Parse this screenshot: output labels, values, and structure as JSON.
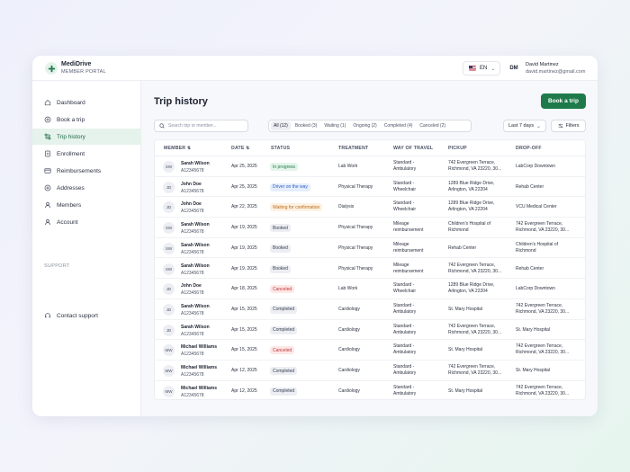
{
  "app": {
    "name": "MediDrive",
    "subtitle": "MEMBER PORTAL"
  },
  "language": {
    "code": "EN"
  },
  "user": {
    "initials": "DM",
    "name": "David Martinez",
    "email": "david.martinez@gmail.com"
  },
  "sidebar": {
    "items": [
      {
        "label": "Dashboard",
        "icon": "home-icon"
      },
      {
        "label": "Book a trip",
        "icon": "plus-circle-icon"
      },
      {
        "label": "Trip history",
        "icon": "route-icon",
        "active": true
      },
      {
        "label": "Enrollment",
        "icon": "document-icon"
      },
      {
        "label": "Reimbursements",
        "icon": "card-icon"
      },
      {
        "label": "Addresses",
        "icon": "location-icon"
      },
      {
        "label": "Members",
        "icon": "users-icon"
      },
      {
        "label": "Account",
        "icon": "user-icon"
      }
    ],
    "support_label": "SUPPORT",
    "support_items": [
      {
        "label": "Contact support",
        "icon": "headset-icon"
      }
    ]
  },
  "main": {
    "title": "Trip history",
    "book_button": "Book a trip",
    "search_placeholder": "Search trip or member...",
    "status_filters": [
      {
        "label": "All (12)",
        "active": true
      },
      {
        "label": "Booked (3)"
      },
      {
        "label": "Waiting (1)"
      },
      {
        "label": "Ongoing (2)"
      },
      {
        "label": "Completed (4)"
      },
      {
        "label": "Canceled (2)"
      }
    ],
    "date_range": "Last 7 days",
    "filters_button": "Filters"
  },
  "table": {
    "headers": {
      "member": "MEMBER ⇅",
      "date": "DATE ⇅",
      "status": "STATUS",
      "treatment": "TREATMENT",
      "travel": "WAY OF TRAVEL",
      "pickup": "PICKUP",
      "dropoff": "DROP-OFF"
    },
    "status_colors": {
      "In progress": {
        "bg": "#e4f5ea",
        "fg": "#1e7a4b"
      },
      "Driver on the way": {
        "bg": "#e6eefc",
        "fg": "#2b5fbf"
      },
      "Waiting for confirmation": {
        "bg": "#fdf1e2",
        "fg": "#b86a12"
      },
      "Booked": {
        "bg": "#eceef3",
        "fg": "#3a4152"
      },
      "Canceled": {
        "bg": "#fde7e7",
        "fg": "#c23434"
      },
      "Completed": {
        "bg": "#eceef3",
        "fg": "#3a4152"
      }
    },
    "rows": [
      {
        "initials": "SW",
        "name": "Sarah Wilson",
        "id": "A12345678",
        "date": "Apr 25, 2025",
        "status": "In progress",
        "treatment": "Lab Work",
        "travel1": "Standard -",
        "travel2": "Ambulatory",
        "pickup1": "742 Evergreen Terrace,",
        "pickup2": "Richmond, VA 23220, 30...",
        "dropoff1": "LabCorp Downtown",
        "dropoff2": ""
      },
      {
        "initials": "JD",
        "name": "John Doe",
        "id": "A12345678",
        "date": "Apr 25, 2025",
        "status": "Driver on the way",
        "treatment": "Physical Therapy",
        "travel1": "Standard -",
        "travel2": "Wheelchair",
        "pickup1": "1289 Blue Ridge Drive,",
        "pickup2": "Arlington, VA 22204",
        "dropoff1": "Rehab Center",
        "dropoff2": ""
      },
      {
        "initials": "JD",
        "name": "John Doe",
        "id": "A12345678",
        "date": "Apr 22, 2025",
        "status": "Waiting for confirmation",
        "treatment": "Dialysis",
        "travel1": "Standard -",
        "travel2": "Wheelchair",
        "pickup1": "1289 Blue Ridge Drive,",
        "pickup2": "Arlington, VA 22204",
        "dropoff1": "VCU Medical Center",
        "dropoff2": ""
      },
      {
        "initials": "SW",
        "name": "Sarah Wilson",
        "id": "A12345678",
        "date": "Apr 19, 2025",
        "status": "Booked",
        "treatment": "Physical Therapy",
        "travel1": "Mileage",
        "travel2": "reimbursement",
        "pickup1": "Children's Hospital of",
        "pickup2": "Richmond",
        "dropoff1": "742 Evergreen Terrace,",
        "dropoff2": "Richmond, VA 23220, 30..."
      },
      {
        "initials": "SW",
        "name": "Sarah Wilson",
        "id": "A12345678",
        "date": "Apr 19, 2025",
        "status": "Booked",
        "treatment": "Physical Therapy",
        "travel1": "Mileage",
        "travel2": "reimbursement",
        "pickup1": "Rehab Center",
        "pickup2": "",
        "dropoff1": "Children's Hospital of",
        "dropoff2": "Richmond"
      },
      {
        "initials": "SW",
        "name": "Sarah Wilson",
        "id": "A12345678",
        "date": "Apr 19, 2025",
        "status": "Booked",
        "treatment": "Physical Therapy",
        "travel1": "Mileage",
        "travel2": "reimbursement",
        "pickup1": "742 Evergreen Terrace,",
        "pickup2": "Richmond, VA 23220, 30...",
        "dropoff1": "Rehab Center",
        "dropoff2": ""
      },
      {
        "initials": "JD",
        "name": "John Doe",
        "id": "A12345678",
        "date": "Apr 18, 2025",
        "status": "Canceled",
        "treatment": "Lab Work",
        "travel1": "Standard -",
        "travel2": "Wheelchair",
        "pickup1": "1289 Blue Ridge Drive,",
        "pickup2": "Arlington, VA 22204",
        "dropoff1": "LabCorp Downtown",
        "dropoff2": ""
      },
      {
        "initials": "JD",
        "name": "Sarah Wilson",
        "id": "A12345678",
        "date": "Apr 15, 2025",
        "status": "Completed",
        "treatment": "Cardiology",
        "travel1": "Standard -",
        "travel2": "Ambulatory",
        "pickup1": "St. Mary Hospital",
        "pickup2": "",
        "dropoff1": "742 Evergreen Terrace,",
        "dropoff2": "Richmond, VA 23220, 30..."
      },
      {
        "initials": "JD",
        "name": "Sarah Wilson",
        "id": "A12345678",
        "date": "Apr 15, 2025",
        "status": "Completed",
        "treatment": "Cardiology",
        "travel1": "Standard -",
        "travel2": "Ambulatory",
        "pickup1": "742 Evergreen Terrace,",
        "pickup2": "Richmond, VA 23220, 30...",
        "dropoff1": "St. Mary Hospital",
        "dropoff2": ""
      },
      {
        "initials": "MW",
        "name": "Michael Williams",
        "id": "A12345678",
        "date": "Apr 15, 2025",
        "status": "Canceled",
        "treatment": "Cardiology",
        "travel1": "Standard -",
        "travel2": "Ambulatory",
        "pickup1": "St. Mary Hospital",
        "pickup2": "",
        "dropoff1": "742 Evergreen Terrace,",
        "dropoff2": "Richmond, VA 23220, 30..."
      },
      {
        "initials": "MW",
        "name": "Michael Williams",
        "id": "A12345678",
        "date": "Apr 12, 2025",
        "status": "Completed",
        "treatment": "Cardiology",
        "travel1": "Standard -",
        "travel2": "Ambulatory",
        "pickup1": "742 Evergreen Terrace,",
        "pickup2": "Richmond, VA 23220, 30...",
        "dropoff1": "St. Mary Hospital",
        "dropoff2": ""
      },
      {
        "initials": "MW",
        "name": "Michael Williams",
        "id": "A12345678",
        "date": "Apr 12, 2025",
        "status": "Completed",
        "treatment": "Cardiology",
        "travel1": "Standard -",
        "travel2": "Ambulatory",
        "pickup1": "St. Mary Hospital",
        "pickup2": "",
        "dropoff1": "742 Evergreen Terrace,",
        "dropoff2": "Richmond, VA 23220, 30..."
      }
    ]
  }
}
